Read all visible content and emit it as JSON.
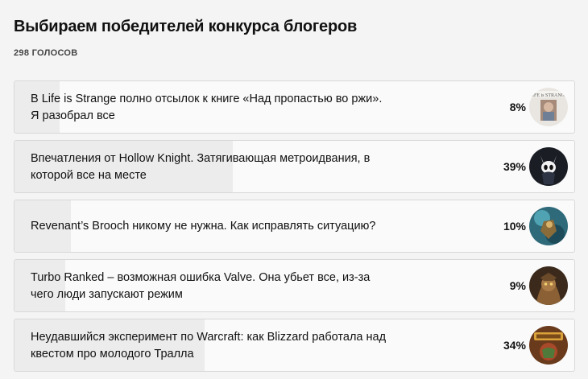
{
  "poll": {
    "title": "Выбираем победителей конкурса блогеров",
    "votes": "298 ГОЛОСОВ",
    "options": [
      {
        "text": "В Life is Strange полно отсылок к книге «Над пропастью во ржи». Я разобрал все",
        "percent_label": "8%",
        "share": 0.08,
        "icon": "life-is-strange-icon"
      },
      {
        "text": "Впечатления от Hollow Knight. Затягивающая метроидвания, в которой все на месте",
        "percent_label": "39%",
        "share": 0.39,
        "icon": "hollow-knight-icon"
      },
      {
        "text": "Revenant’s Brooch никому не нужна. Как исправлять ситуацию?",
        "percent_label": "10%",
        "share": 0.1,
        "icon": "revenant-icon"
      },
      {
        "text": "Turbo Ranked – возможная ошибка Valve. Она убьет все, из-за чего люди запускают режим",
        "percent_label": "9%",
        "share": 0.09,
        "icon": "turbo-ranked-icon"
      },
      {
        "text": "Неудавшийся эксперимент по Warcraft: как Blizzard работала над квестом про молодого Тралла",
        "percent_label": "34%",
        "share": 0.34,
        "icon": "warcraft-icon"
      }
    ]
  }
}
